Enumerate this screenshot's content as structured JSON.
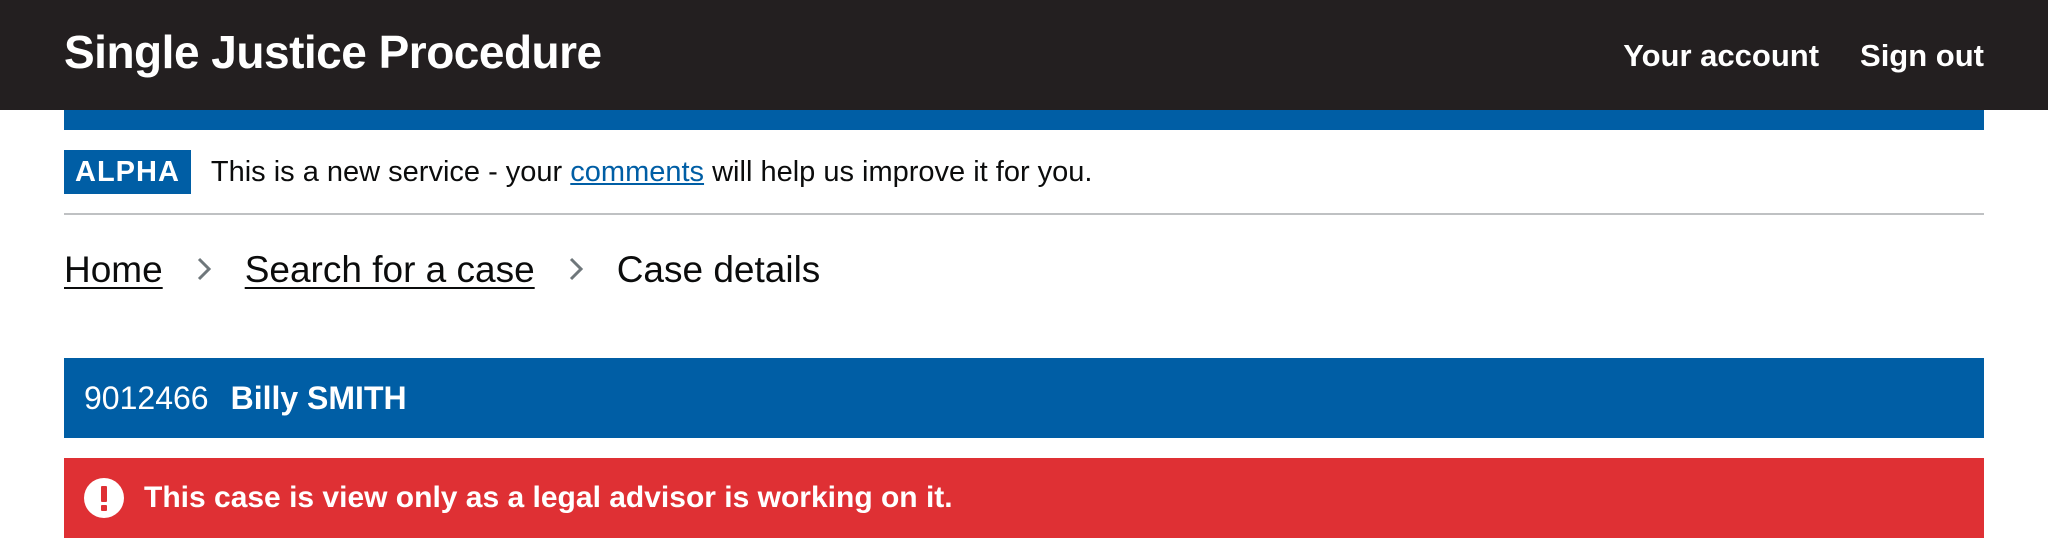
{
  "header": {
    "service_name": "Single Justice Procedure",
    "nav": {
      "your_account": "Your account",
      "sign_out": "Sign out"
    }
  },
  "phase_banner": {
    "tag": "ALPHA",
    "text_before": "This is a new service - your",
    "link_text": "comments",
    "text_after": "will help us improve it for you."
  },
  "breadcrumb": {
    "items": [
      {
        "label": "Home"
      },
      {
        "label": "Search for a case"
      },
      {
        "label": "Case details"
      }
    ],
    "separator": "›"
  },
  "case": {
    "number": "9012466",
    "name": "Billy SMITH"
  },
  "warning": {
    "text": "This case is view only as a legal advisor is working on it.",
    "icon": "exclamation-icon"
  },
  "colors": {
    "header_bg": "#231f20",
    "brand_blue": "#005ea5",
    "warning_red": "#df3034",
    "divider": "#bfc1c3"
  }
}
